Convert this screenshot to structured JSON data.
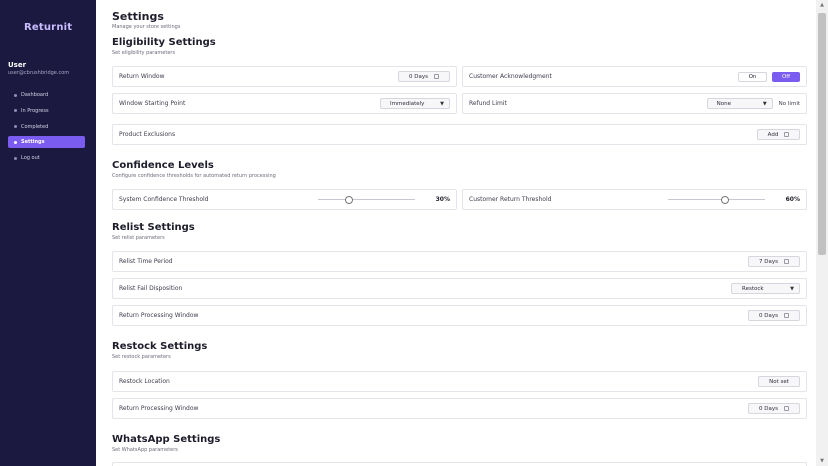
{
  "sidebar": {
    "logo": "Returnit",
    "user_name": "User",
    "user_email": "user@cbrushbridge.com",
    "nav": [
      {
        "label": "Dashboard",
        "active": false
      },
      {
        "label": "In Progress",
        "active": false
      },
      {
        "label": "Completed",
        "active": false
      },
      {
        "label": "Settings",
        "active": true
      },
      {
        "label": "Log out",
        "active": false
      }
    ]
  },
  "page": {
    "title": "Settings",
    "subtitle": "Manage your store settings"
  },
  "eligibility": {
    "title": "Eligibility Settings",
    "subtitle": "Set eligibility parameters",
    "return_window": {
      "label": "Return Window",
      "value": "0 Days"
    },
    "customer_ack": {
      "label": "Customer Acknowledgment",
      "on_label": "On",
      "off_label": "Off"
    },
    "window_start": {
      "label": "Window Starting Point",
      "value": "Immediately"
    },
    "refund_limit": {
      "label": "Refund Limit",
      "value": "None",
      "note": "No limit"
    },
    "product_exclusions": {
      "label": "Product Exclusions",
      "button": "Add"
    }
  },
  "confidence": {
    "title": "Confidence Levels",
    "subtitle": "Configure confidence thresholds for automated return processing",
    "system": {
      "label": "System Confidence Threshold",
      "value": 30,
      "display": "30%"
    },
    "customer": {
      "label": "Customer Return Threshold",
      "value": 60,
      "display": "60%"
    }
  },
  "relist": {
    "title": "Relist Settings",
    "subtitle": "Set relist parameters",
    "time_period": {
      "label": "Relist Time Period",
      "value": "7 Days"
    },
    "fail_disposition": {
      "label": "Relist Fail Disposition",
      "value": "Restock"
    },
    "processing_window": {
      "label": "Return Processing Window",
      "value": "0 Days"
    }
  },
  "restock": {
    "title": "Restock Settings",
    "subtitle": "Set restock parameters",
    "location": {
      "label": "Restock Location",
      "value": "Not set"
    },
    "processing_window": {
      "label": "Return Processing Window",
      "value": "0 Days"
    }
  },
  "whatsapp": {
    "title": "WhatsApp Settings",
    "subtitle": "Set WhatsApp parameters"
  },
  "colors": {
    "accent": "#7b5cf0",
    "sidebar_bg": "#1c1940"
  }
}
